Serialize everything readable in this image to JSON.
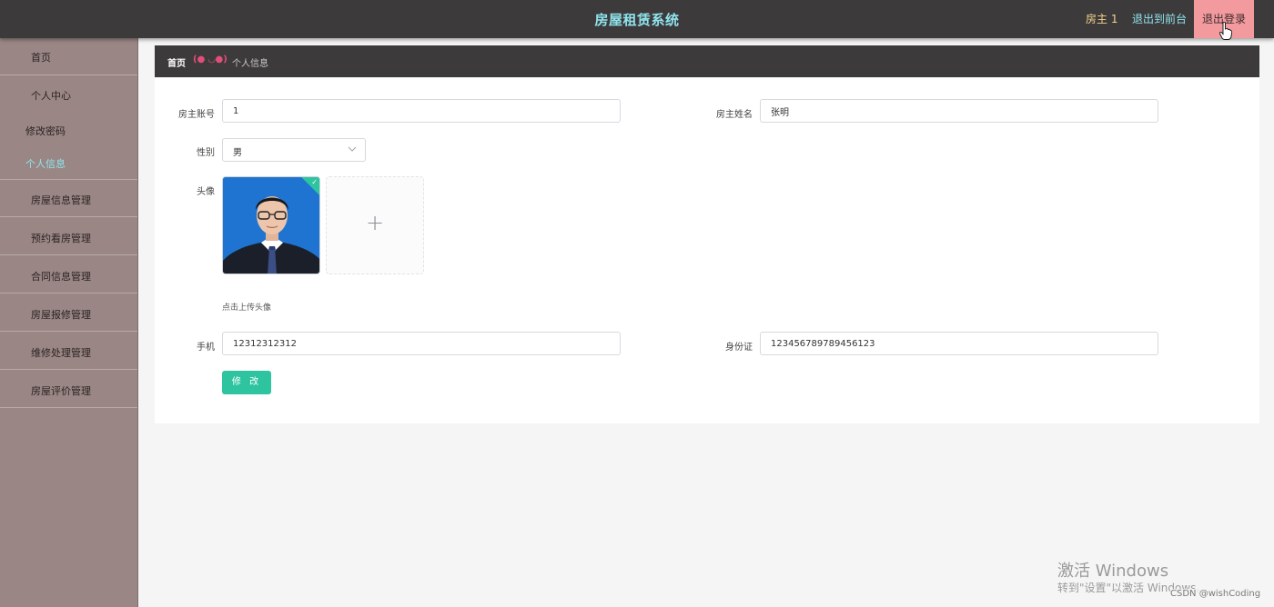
{
  "header": {
    "title": "房屋租赁系统",
    "user": "房主 1",
    "to_front": "退出到前台",
    "logout": "退出登录"
  },
  "sidebar": {
    "items": [
      {
        "label": "首页"
      },
      {
        "label": "个人中心"
      },
      {
        "label": "修改密码"
      },
      {
        "label": "个人信息"
      },
      {
        "label": "房屋信息管理"
      },
      {
        "label": "预约看房管理"
      },
      {
        "label": "合同信息管理"
      },
      {
        "label": "房屋报修管理"
      },
      {
        "label": "维修处理管理"
      },
      {
        "label": "房屋评价管理"
      }
    ]
  },
  "breadcrumb": {
    "home": "首页",
    "separator": "(● ◡●)",
    "current": "个人信息"
  },
  "form": {
    "account_label": "房主账号",
    "account_value": "1",
    "name_label": "房主姓名",
    "name_value": "张明",
    "gender_label": "性别",
    "gender_value": "男",
    "avatar_label": "头像",
    "avatar_hint": "点击上传头像",
    "phone_label": "手机",
    "phone_value": "12312312312",
    "id_label": "身份证",
    "id_value": "123456789789456123",
    "submit": "修 改"
  },
  "watermark": {
    "line1": "激活 Windows",
    "line2": "转到\"设置\"以激活 Windows。",
    "csdn": "CSDN @wishCoding"
  },
  "colors": {
    "topbar": "#3d3a3c",
    "title": "#8fe4ec",
    "sidebar": "#9a8785",
    "accent": "#2fc4a0",
    "logout": "#f29a9e"
  }
}
